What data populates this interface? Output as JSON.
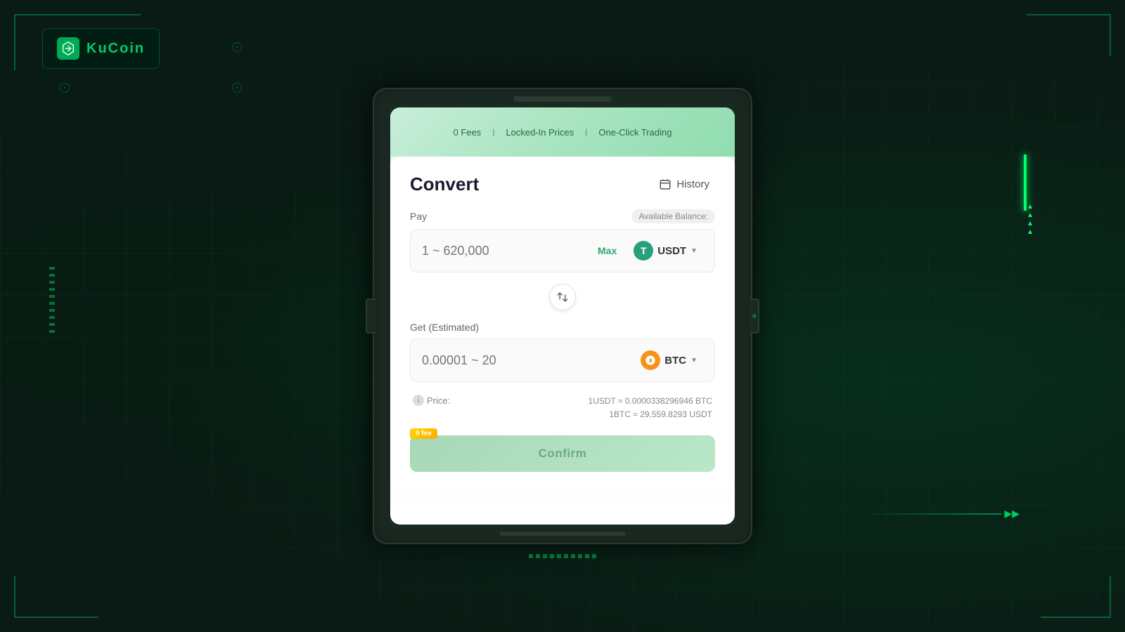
{
  "app": {
    "title": "KuCoin",
    "logo_letter": "K"
  },
  "header_features": {
    "fee": "0 Fees",
    "price": "Locked-In Prices",
    "trading": "One-Click Trading"
  },
  "convert": {
    "title": "Convert",
    "history_label": "History"
  },
  "pay_section": {
    "label": "Pay",
    "available_balance_label": "Available Balance:",
    "placeholder": "1 ~ 620,000",
    "max_label": "Max",
    "currency": "USDT",
    "currency_symbol": "T"
  },
  "get_section": {
    "label": "Get (Estimated)",
    "placeholder": "0.00001 ~ 20",
    "currency": "BTC",
    "currency_symbol": "₿"
  },
  "price_info": {
    "label": "Price:",
    "line1": "1USDT ≈ 0.0000338296946 BTC",
    "line2": "1BTC ≈ 29,559.8293 USDT"
  },
  "confirm_btn": {
    "label": "Confirm",
    "fee_badge": "0 fee"
  }
}
